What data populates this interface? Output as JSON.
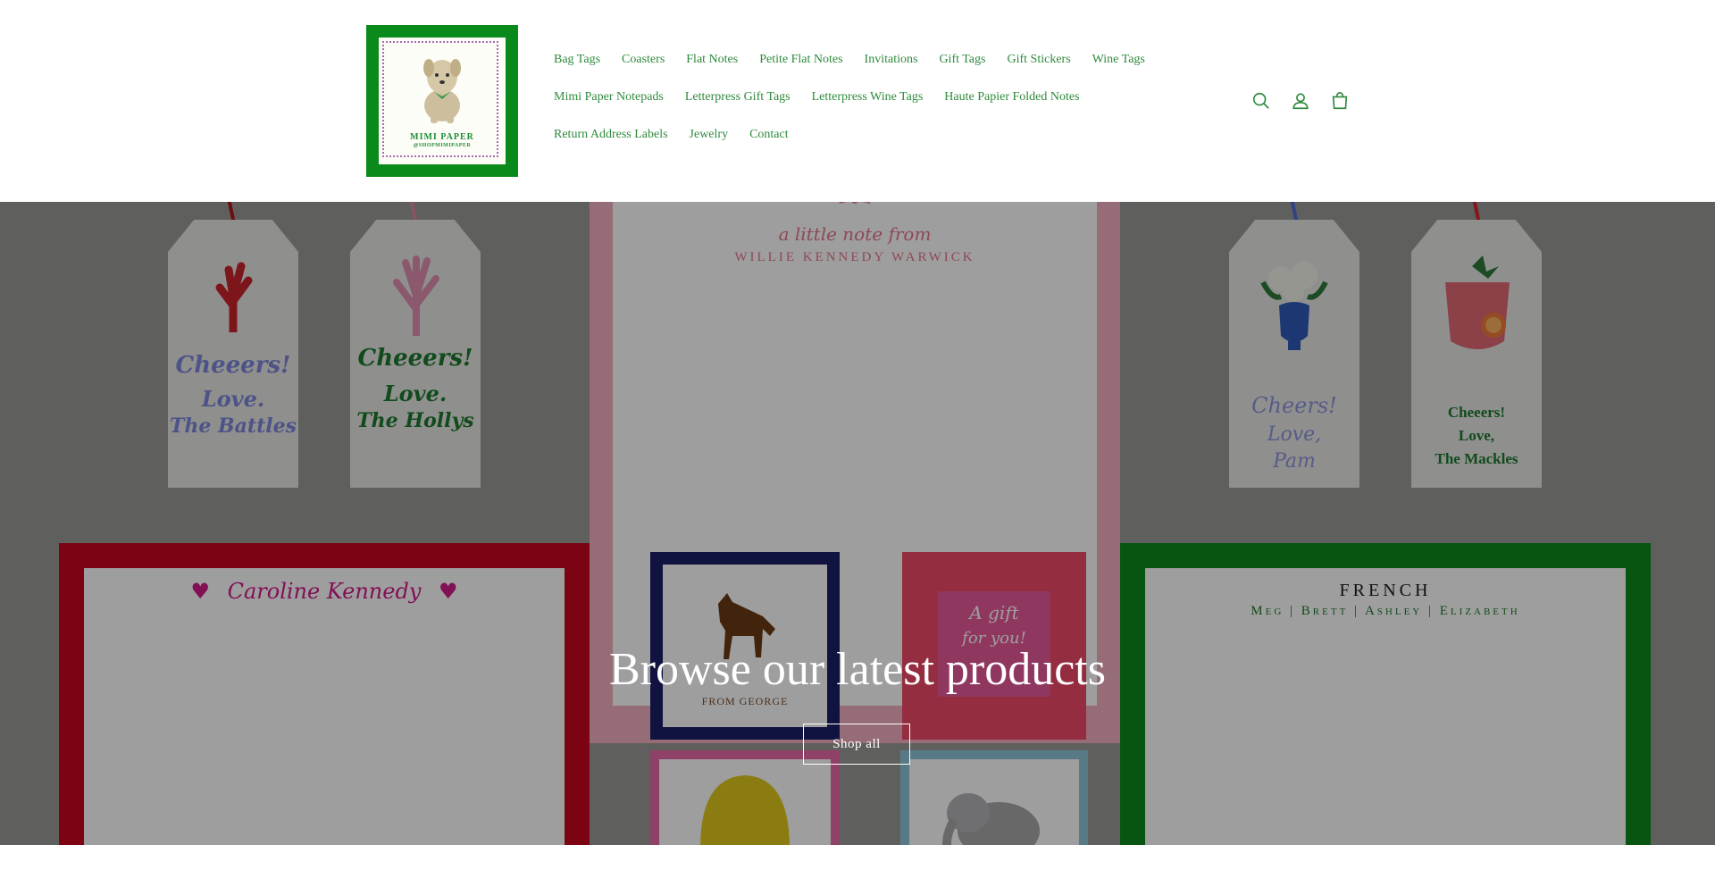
{
  "header": {
    "logo": {
      "line1": "MIMI PAPER",
      "line2": "@SHOPMIMIPAPER",
      "icon": "dog-logo-icon",
      "frame_color": "#0a8a1a"
    },
    "nav_rows": [
      [
        "Bag Tags",
        "Coasters",
        "Flat Notes",
        "Petite Flat Notes",
        "Invitations",
        "Gift Tags",
        "Gift Stickers",
        "Wine Tags"
      ],
      [
        "Mimi Paper Notepads",
        "Letterpress Gift Tags",
        "Letterpress Wine Tags",
        "Haute Papier Folded Notes"
      ],
      [
        "Return Address Labels",
        "Jewelry",
        "Contact"
      ]
    ],
    "icons": [
      "search-icon",
      "account-icon",
      "cart-icon"
    ],
    "accent_color": "#2f8a3d"
  },
  "banner": {
    "title": "Browse our latest products",
    "button_label": "Shop all",
    "products": {
      "tag1": {
        "line1": "Cheeers!",
        "line2": "Love.",
        "line3": "The Battles"
      },
      "tag2": {
        "line1": "Cheeers!",
        "line2": "Love.",
        "line3": "The Hollys"
      },
      "tag3": {
        "line1": "Cheers!",
        "line2": "Love,",
        "line3": "Pam"
      },
      "tag4": {
        "line1": "Cheeers!",
        "line2": "Love,",
        "line3": "The Mackles"
      },
      "note_pink": {
        "line1": "a little note from",
        "line2": "WILLIE KENNEDY WARWICK"
      },
      "note_red": {
        "name": "Caroline Kennedy"
      },
      "note_green": {
        "line1": "FRENCH",
        "line2": "Meg | Brett | Ashley | Elizabeth"
      },
      "horse_card": {
        "line1": "FROM GEORGE"
      },
      "gift_card": {
        "line1": "A gift",
        "line2": "for you!"
      }
    }
  }
}
